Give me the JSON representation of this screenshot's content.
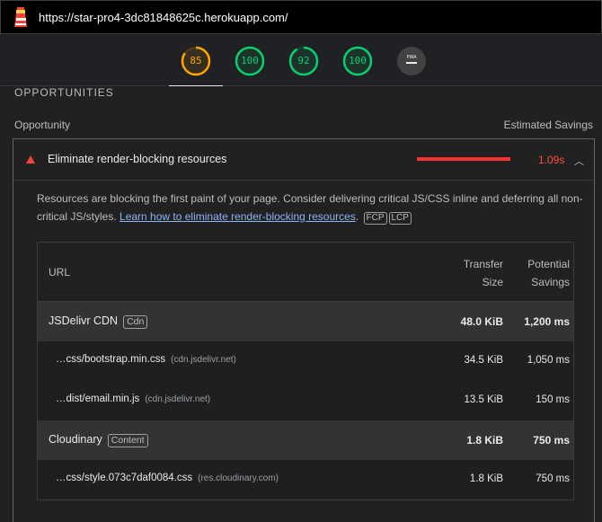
{
  "browser": {
    "url": "https://star-pro4-3dc81848625c.herokuapp.com/"
  },
  "gauges": [
    {
      "label": "85",
      "color": "#ffa400",
      "fraction": 0.85
    },
    {
      "label": "100",
      "color": "#0cce6b",
      "fraction": 1.0
    },
    {
      "label": "92",
      "color": "#0cce6b",
      "fraction": 0.92
    },
    {
      "label": "100",
      "color": "#0cce6b",
      "fraction": 1.0
    },
    {
      "label": "PWA",
      "color": "#9aa0a6",
      "fraction": 0
    }
  ],
  "section": {
    "title": "OPPORTUNITIES",
    "col_left": "Opportunity",
    "col_right": "Estimated Savings"
  },
  "audit": {
    "title": "Eliminate render-blocking resources",
    "savings": "1.09s",
    "description": "Resources are blocking the first paint of your page. Consider delivering critical JS/CSS inline and deferring all non-critical JS/styles. ",
    "link_text": "Learn how to eliminate render-blocking resources",
    "tags": [
      "FCP",
      "LCP"
    ],
    "color_fail": "#ff4e42",
    "link_color": "#8ab4f8"
  },
  "table": {
    "col_url": "URL",
    "col_transfer_1": "Transfer",
    "col_transfer_2": "Size",
    "col_potential_1": "Potential",
    "col_potential_2": "Savings",
    "rows": [
      {
        "name": "JSDelivr CDN",
        "tag": "Cdn",
        "size": "48.0 KiB",
        "time": "1,200 ms"
      },
      {
        "name": "…css/bootstrap.min.css",
        "host": "(cdn.jsdelivr.net)",
        "size": "34.5 KiB",
        "time": "1,050 ms"
      },
      {
        "name": "…dist/email.min.js",
        "host": "(cdn.jsdelivr.net)",
        "size": "13.5 KiB",
        "time": "150 ms"
      },
      {
        "name": "Cloudinary",
        "tag": "Content",
        "size": "1.8 KiB",
        "time": "750 ms"
      },
      {
        "name": "…css/style.073c7daf0084.css",
        "host": "(res.cloudinary.com)",
        "size": "1.8 KiB",
        "time": "750 ms"
      }
    ]
  }
}
